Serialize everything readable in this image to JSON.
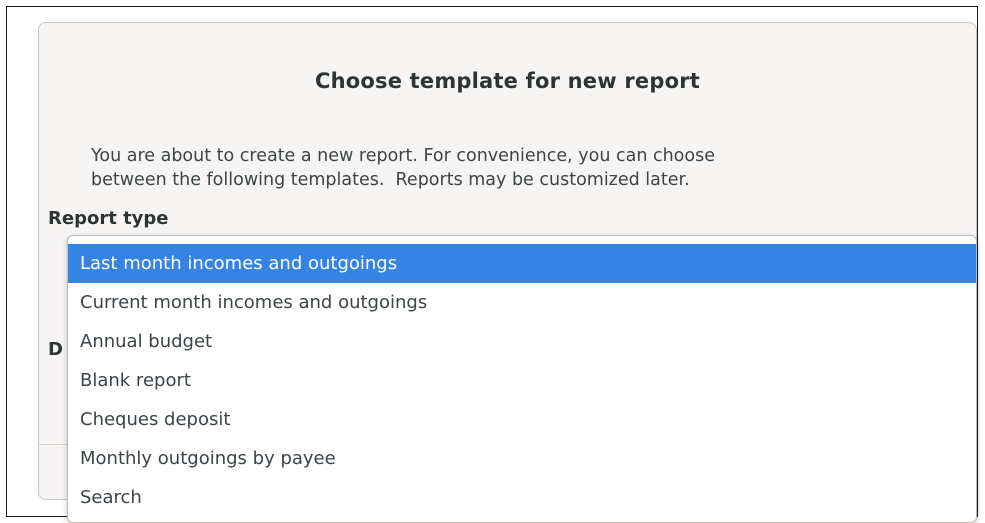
{
  "dialog": {
    "title": "Choose template for new report",
    "description_line1": "You are about to create a new report. For convenience, you can choose",
    "description_line2": "between the following templates.  Reports may be customized later.",
    "report_type_label": "Report type",
    "partially_hidden_label": "D"
  },
  "dropdown": {
    "selected_index": 0,
    "options": [
      "Last month incomes and outgoings",
      "Current month incomes and outgoings",
      "Annual budget",
      "Blank report",
      "Cheques deposit",
      "Monthly outgoings by payee",
      "Search"
    ]
  },
  "colors": {
    "selection": "#3584e4",
    "dialog_background": "#f6f5f4"
  }
}
